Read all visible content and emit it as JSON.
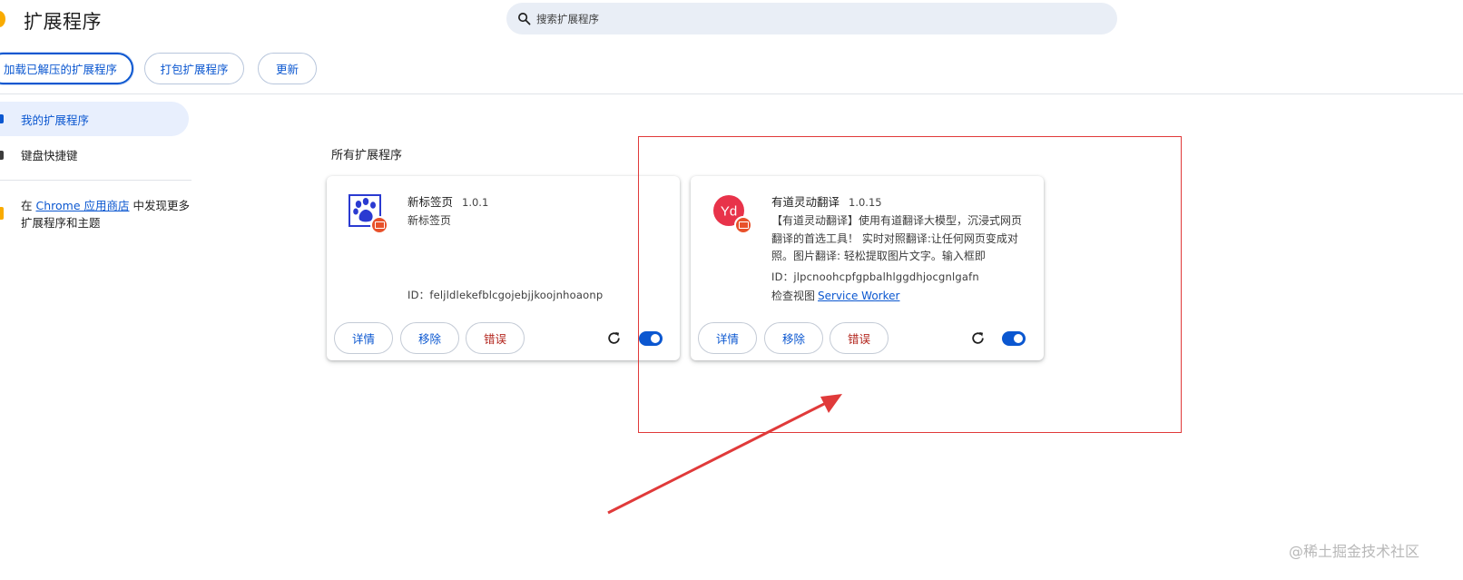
{
  "header": {
    "title": "扩展程序",
    "search_placeholder": "搜索扩展程序"
  },
  "toolbar": {
    "load_unpacked": "加载已解压的扩展程序",
    "pack": "打包扩展程序",
    "update": "更新"
  },
  "sidebar": {
    "items": [
      {
        "label": "我的扩展程序",
        "icon": "puzzle-icon",
        "active": true
      },
      {
        "label": "键盘快捷键",
        "icon": "keyboard-icon",
        "active": false
      }
    ],
    "store": {
      "prefix": "在 ",
      "link": "Chrome 应用商店",
      "suffix": " 中发现更多扩展程序和主题"
    }
  },
  "section_title": "所有扩展程序",
  "extensions": [
    {
      "name": "新标签页",
      "version": "1.0.1",
      "description": "新标签页",
      "id": "ID：feljldlekefblcgojebjjkoojnhoaonp",
      "icon": "paw-icon",
      "buttons": {
        "details": "详情",
        "remove": "移除",
        "errors": "错误"
      },
      "enabled": true
    },
    {
      "name": "有道灵动翻译",
      "version": "1.0.15",
      "description": "【有道灵动翻译】使用有道翻译大模型，沉浸式网页翻译的首选工具！ 实时对照翻译:让任何网页变成对照。图片翻译: 轻松提取图片文字。输入框即",
      "id": "ID：jlpcnoohcpfgpbalhlggdhjocgnlgafn",
      "inspect_label": "检查视图",
      "inspect_link": "Service Worker",
      "icon": "youdao-icon",
      "buttons": {
        "details": "详情",
        "remove": "移除",
        "errors": "错误"
      },
      "enabled": true
    }
  ],
  "watermark": "@稀土掘金技术社区",
  "colors": {
    "accent": "#0b57d0",
    "error": "#b3261e",
    "annotation": "#e03a3a",
    "search_bg": "#e9eef6"
  }
}
